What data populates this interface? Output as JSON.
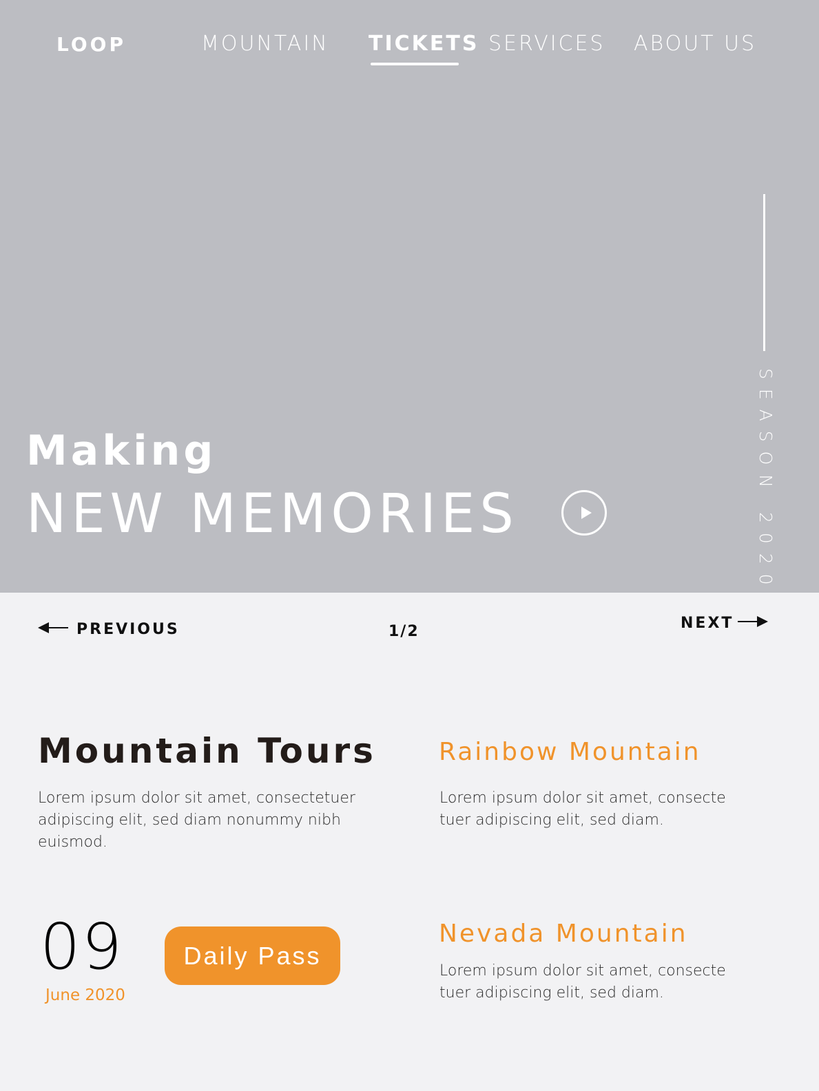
{
  "nav": {
    "logo": "LOOP",
    "items": [
      {
        "label": "MOUNTAIN"
      },
      {
        "label": "TICKETS",
        "active": true
      },
      {
        "label": "SERVICES"
      },
      {
        "label": "ABOUT US"
      }
    ]
  },
  "hero": {
    "side_label": "SEASON 2020",
    "subtitle": "Making",
    "title": "NEW MEMORIES",
    "play_icon": "play-circle-icon"
  },
  "pager": {
    "previous_label": "PREVIOUS",
    "next_label": "NEXT",
    "counter": "1/2"
  },
  "tours": {
    "title": "Mountain Tours",
    "description": "Lorem ipsum dolor sit amet, consectetuer adipiscing elit, sed diam nonummy nibh euismod."
  },
  "event": {
    "day": "09",
    "month": "June 2020",
    "button_label": "Daily Pass"
  },
  "destinations": [
    {
      "title": "Rainbow Mountain",
      "description": "Lorem ipsum dolor sit amet, consecte tuer adipiscing elit, sed diam."
    },
    {
      "title": "Nevada Mountain",
      "description": "Lorem ipsum dolor sit amet, consecte tuer adipiscing elit, sed diam."
    }
  ],
  "colors": {
    "hero_bg": "#bcbdc2",
    "page_bg": "#f2f2f4",
    "accent": "#f0932b",
    "heading": "#231c19"
  }
}
